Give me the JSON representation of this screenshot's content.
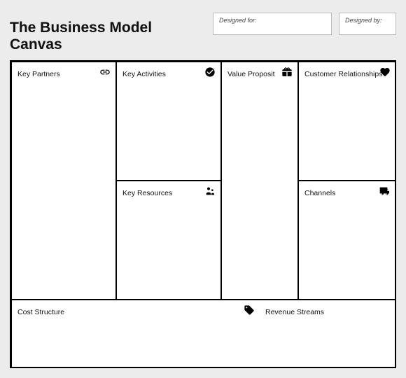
{
  "header": {
    "title": "The Business Model Canvas",
    "designed_for_label": "Designed for:",
    "designed_by_label": "Designed by:"
  },
  "cells": {
    "key_partners": "Key Partners",
    "key_activities": "Key Activities",
    "key_resources": "Key Resources",
    "value_proposition": "Value Proposit",
    "customer_relationships": "Customer Relationships",
    "channels": "Channels",
    "cost_structure": "Cost Structure",
    "revenue_streams": "Revenue Streams"
  }
}
